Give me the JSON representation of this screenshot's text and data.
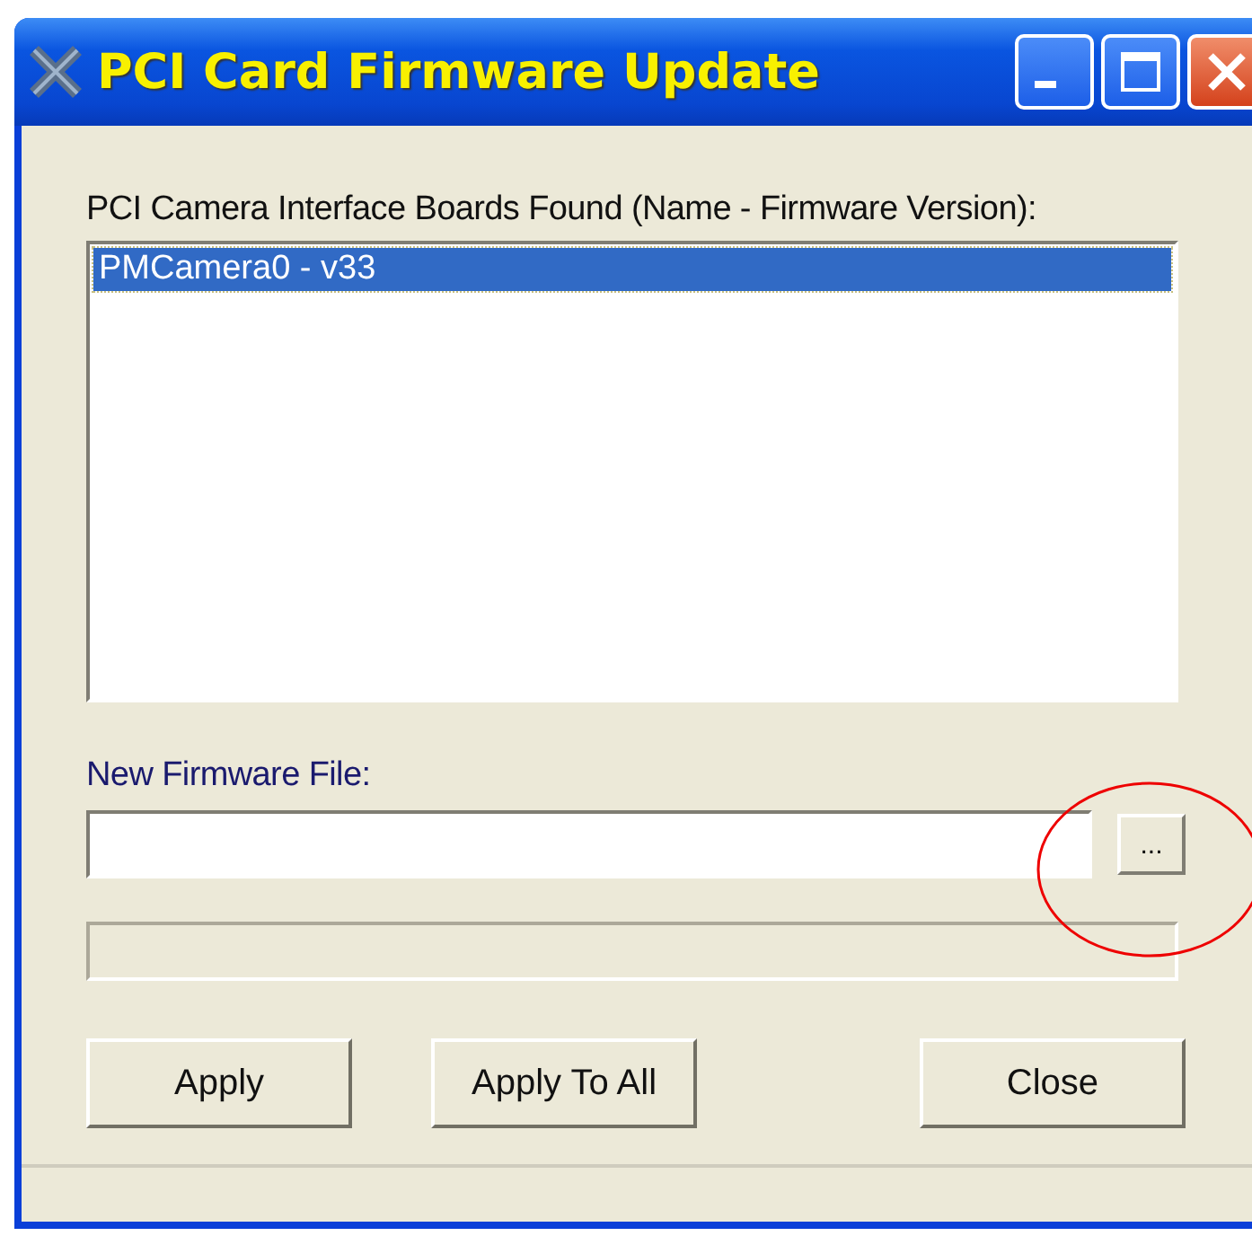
{
  "window": {
    "title": "PCI Card Firmware Update"
  },
  "boards": {
    "label": "PCI Camera Interface Boards Found (Name - Firmware Version):",
    "items": [
      {
        "text": "PMCamera0 - v33",
        "selected": true
      }
    ]
  },
  "firmware_file": {
    "label": "New Firmware File:",
    "browse_button": "..."
  },
  "progress": {
    "level": 0
  },
  "buttons": [
    "Apply",
    "Apply To All",
    "Close"
  ]
}
